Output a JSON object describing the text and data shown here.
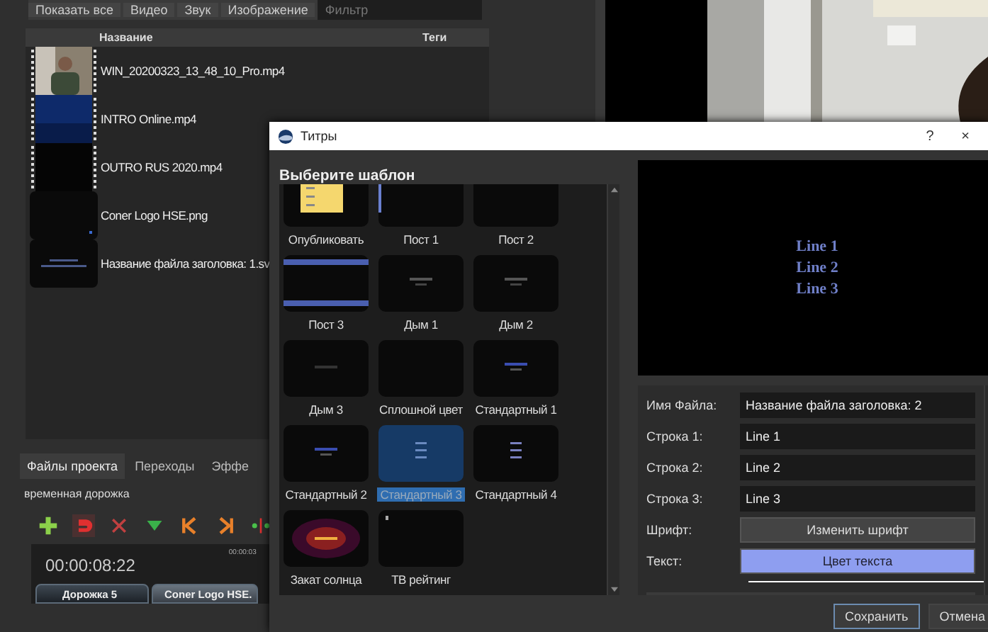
{
  "filter_tabs": [
    {
      "label": "Показать все",
      "selected": false
    },
    {
      "label": "Видео",
      "selected": false
    },
    {
      "label": "Звук",
      "selected": false
    },
    {
      "label": "Изображение",
      "selected": false
    }
  ],
  "filter_placeholder": "Фильтр",
  "files": {
    "columns": [
      "Название",
      "Теги"
    ],
    "rows": [
      {
        "name": "WIN_20200323_13_48_10_Pro.mp4"
      },
      {
        "name": "INTRO Online.mp4",
        "kind": "blue"
      },
      {
        "name": "OUTRO RUS 2020.mp4",
        "kind": "black"
      },
      {
        "name": "Coner Logo HSE.png",
        "kind": "logo"
      },
      {
        "name": "Название файла заголовка: 1.sv",
        "kind": "title"
      }
    ]
  },
  "bottom_tabs": [
    {
      "label": "Файлы проекта",
      "selected": true
    },
    {
      "label": "Переходы",
      "selected": false
    },
    {
      "label": "Эффе",
      "selected": false
    }
  ],
  "timeline": {
    "title": "временная дорожка",
    "snap": true,
    "time": "00:00:08:22",
    "ruler_label": "00:00:03",
    "tracks": [
      {
        "label": "Дорожка 5",
        "kind": "track"
      },
      {
        "label": "Coner Logo HSE.",
        "kind": "clip"
      }
    ]
  },
  "dialog": {
    "title": "Титры",
    "help": "?",
    "close": "×",
    "heading": "Выберите шаблон",
    "templates": [
      {
        "label": "Опубликовать",
        "kind": "note",
        "selected": false
      },
      {
        "label": "Пост 1",
        "kind": "edge",
        "selected": false
      },
      {
        "label": "Пост 2",
        "kind": "dark",
        "selected": false
      },
      {
        "label": "Пост 3",
        "kind": "banner",
        "selected": false
      },
      {
        "label": "Дым 1",
        "kind": "grey_title",
        "selected": false
      },
      {
        "label": "Дым 2",
        "kind": "grey_title",
        "selected": false
      },
      {
        "label": "Дым 3",
        "kind": "faint_title",
        "selected": false
      },
      {
        "label": "Сплошной цвет",
        "kind": "dark",
        "selected": false
      },
      {
        "label": "Стандартный 1",
        "kind": "blue_title",
        "selected": false
      },
      {
        "label": "Стандартный 2",
        "kind": "blue_title",
        "selected": false
      },
      {
        "label": "Стандартный 3",
        "kind": "lines",
        "selected": true
      },
      {
        "label": "Стандартный 4",
        "kind": "lines",
        "selected": false
      },
      {
        "label": "Закат солнца",
        "kind": "sunset",
        "selected": false
      },
      {
        "label": "ТВ рейтинг",
        "kind": "rating",
        "selected": false
      }
    ],
    "preview_lines": [
      "Line 1",
      "Line 2",
      "Line 3"
    ],
    "form": [
      {
        "label": "Имя Файла:",
        "kind": "field",
        "value": "Название файла заголовка: 2"
      },
      {
        "label": "Строка 1:",
        "kind": "field",
        "value": "Line 1"
      },
      {
        "label": "Строка 2:",
        "kind": "field",
        "value": "Line 2"
      },
      {
        "label": "Строка 3:",
        "kind": "field",
        "value": "Line 3"
      },
      {
        "label": "Шрифт:",
        "kind": "button",
        "value": "Изменить шрифт"
      },
      {
        "label": "Текст:",
        "kind": "color",
        "value": "Цвет текста"
      }
    ],
    "buttons": [
      {
        "label": "Сохранить",
        "default": true
      },
      {
        "label": "Отмена",
        "default": false
      }
    ]
  }
}
